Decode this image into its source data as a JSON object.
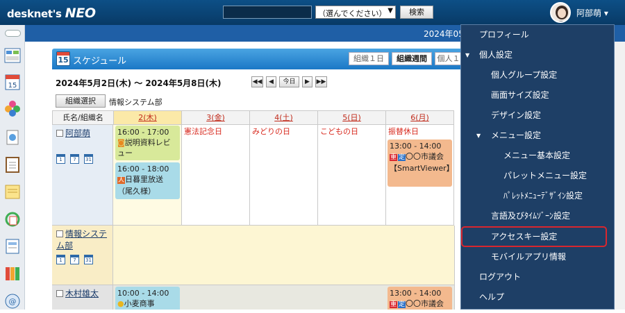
{
  "app": {
    "logo_prefix": "desknet's",
    "logo_main": "NEO"
  },
  "header": {
    "search_placeholder": "",
    "scope_select": "（選んでください）",
    "search_button": "検索",
    "user_name": "阿部萌"
  },
  "date_bar": {
    "text": "2024年05"
  },
  "leftbar_icons": [
    "toggle-icon",
    "dashboard-icon",
    "calendar-icon",
    "cloud-icon",
    "approval-icon",
    "clipboard-icon",
    "memo-icon",
    "recycle-icon",
    "report-icon",
    "books-icon",
    "mail-icon"
  ],
  "schedule": {
    "title": "スケジュール",
    "icon_day": "15",
    "view_buttons": [
      "組織１日",
      "組織週間",
      "個人１"
    ],
    "range": "2024年5月2日(木) ～ 2024年5月8日(木)",
    "nav": [
      "◀◀",
      "◀",
      "今日",
      "▶",
      "▶▶"
    ],
    "org_select_button": "組織選択",
    "org_name": "情報システム部",
    "headers": [
      "氏名/組織名",
      "2(木)",
      "3(金)",
      "4(土)",
      "5(日)",
      "6(月)"
    ],
    "holidays": {
      "3": "憲法記念日",
      "4": "みどりの日",
      "5": "こどもの日",
      "6": "振替休日"
    },
    "rows": [
      {
        "name": "阿部萌",
        "cal_icons": [
          "1",
          "7",
          "31"
        ]
      },
      {
        "name": "情報システム部",
        "cal_icons": [
          "1",
          "7",
          "31"
        ]
      },
      {
        "name": "木村雄太",
        "cal_icons": []
      }
    ],
    "events": [
      {
        "time": "16:00 - 17:00",
        "title": "説明資料レビュー"
      },
      {
        "time": "16:00 - 18:00",
        "title": "日暮里放送（尾久様）"
      },
      {
        "time": "13:00 - 14:00",
        "badges": [
          "重",
          "定"
        ],
        "title": "〇〇市議会【SmartViewer】"
      },
      {
        "time": "10:00 - 14:00",
        "title": "小麦商事"
      },
      {
        "time": "13:00 - 14:00",
        "badges": [
          "重",
          "定"
        ],
        "title": "〇〇市議会"
      }
    ]
  },
  "user_menu": {
    "items": [
      {
        "label": "プロフィール",
        "level": 0
      },
      {
        "label": "個人設定",
        "level": 0,
        "expanded": true
      },
      {
        "label": "個人グループ設定",
        "level": 1
      },
      {
        "label": "画面サイズ設定",
        "level": 1
      },
      {
        "label": "デザイン設定",
        "level": 1
      },
      {
        "label": "メニュー設定",
        "level": 1,
        "expanded": true
      },
      {
        "label": "メニュー基本設定",
        "level": 2
      },
      {
        "label": "パレットメニュー設定",
        "level": 2
      },
      {
        "label": "ﾊﾟﾚｯﾄﾒﾆｭｰﾃﾞｻﾞｲﾝ設定",
        "level": 2
      },
      {
        "label": "言語及びﾀｲﾑｿﾞｰﾝ設定",
        "level": 1
      },
      {
        "label": "アクセスキー設定",
        "level": 1,
        "highlighted": true
      },
      {
        "label": "モバイルアプリ情報",
        "level": 1
      },
      {
        "label": "ログアウト",
        "level": 0
      },
      {
        "label": "ヘルプ",
        "level": 0
      }
    ],
    "expand_glyph": "▼"
  },
  "colors": {
    "header_bg": "#0d4f86",
    "menu_bg": "#1e3f66",
    "highlight": "#d9262e",
    "holiday": "#d82a1f"
  }
}
